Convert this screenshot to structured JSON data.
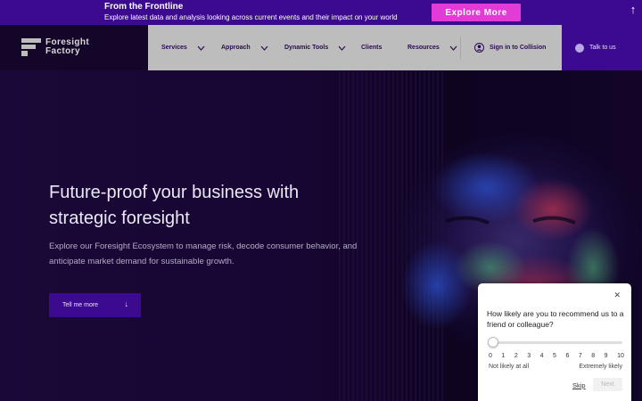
{
  "promo": {
    "title": "From the Frontline",
    "subtitle": "Explore latest data and analysis looking across current events and their impact on your world",
    "button_label": "Explore More"
  },
  "brand": {
    "line1": "Foresight",
    "line2": "Factory"
  },
  "nav": {
    "items": [
      {
        "label": "Services",
        "has_dropdown": true
      },
      {
        "label": "Approach",
        "has_dropdown": true
      },
      {
        "label": "Dynamic Tools",
        "has_dropdown": true
      },
      {
        "label": "Clients",
        "has_dropdown": false
      },
      {
        "label": "Resources",
        "has_dropdown": true
      }
    ],
    "signin_label": "Sign in to Collision",
    "talk_label": "Talk to us"
  },
  "hero": {
    "title_line1": "Future-proof your business with",
    "title_line2": "strategic foresight",
    "text": "Explore our Foresight Ecosystem to manage risk, decode consumer behavior, and anticipate market demand for sustainable growth.",
    "button_label": "Tell me more"
  },
  "survey": {
    "close_icon": "close-icon",
    "question": "How likely are you to recommend us to a friend or colleague?",
    "scale": [
      "0",
      "1",
      "2",
      "3",
      "4",
      "5",
      "6",
      "7",
      "8",
      "9",
      "10"
    ],
    "low_label": "Not likely at all",
    "high_label": "Extremely likely",
    "skip_label": "Skip",
    "next_label": "Next"
  },
  "colors": {
    "accent": "#3b0a8f",
    "promo_button": "#e23bd6",
    "nav_bg": "#bdbdbd",
    "hero_bg": "#170633"
  }
}
